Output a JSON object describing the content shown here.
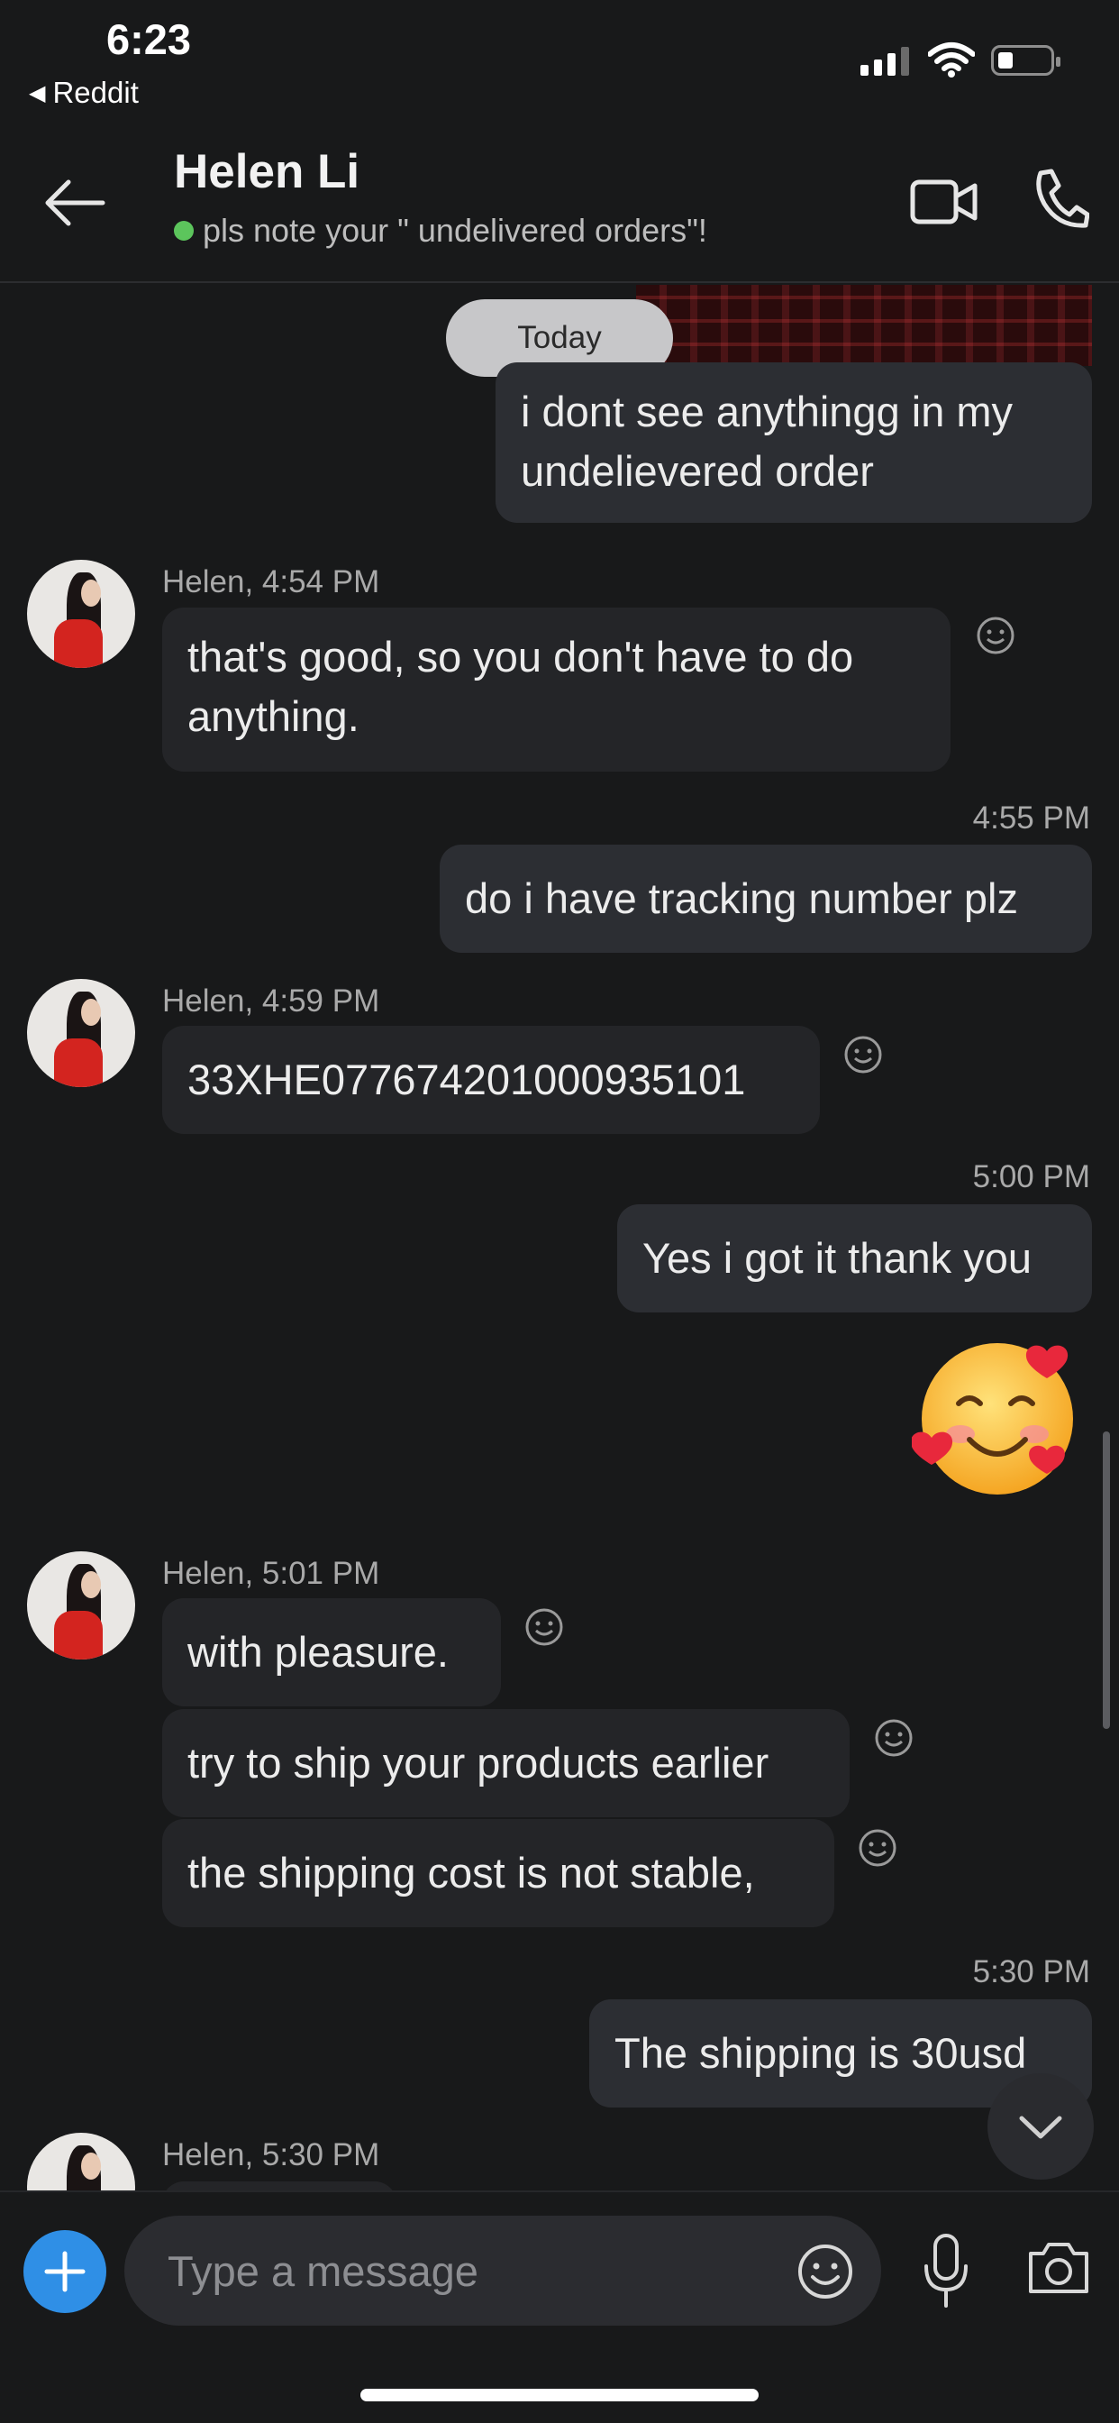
{
  "status_bar": {
    "time": "6:23",
    "back_app": "Reddit"
  },
  "header": {
    "contact_name": "Helen Li",
    "status_text": "pls note your \" undelivered orders\"!"
  },
  "chat": {
    "date_label": "Today",
    "messages": [
      {
        "text": "i dont see anythingg in my undelievered order"
      },
      {
        "sender": "Helen, 4:54 PM",
        "text": "that's good, so you don't have to do anything."
      },
      {
        "time": "4:55 PM",
        "text": "do i have tracking number plz"
      },
      {
        "sender": "Helen, 4:59 PM",
        "text": "33XHE07767420100093510​1"
      },
      {
        "time": "5:00 PM",
        "text": "Yes i got it thank you"
      },
      {
        "emoji": "🥰"
      },
      {
        "sender": "Helen, 5:01 PM",
        "text": "with pleasure."
      },
      {
        "text": "try to ship your products earlier"
      },
      {
        "text": "the shipping cost is not stable,"
      },
      {
        "time": "5:30 PM",
        "text": "The shipping is 30usd"
      },
      {
        "sender": "Helen, 5:30 PM"
      }
    ]
  },
  "composer": {
    "placeholder": "Type a message"
  }
}
